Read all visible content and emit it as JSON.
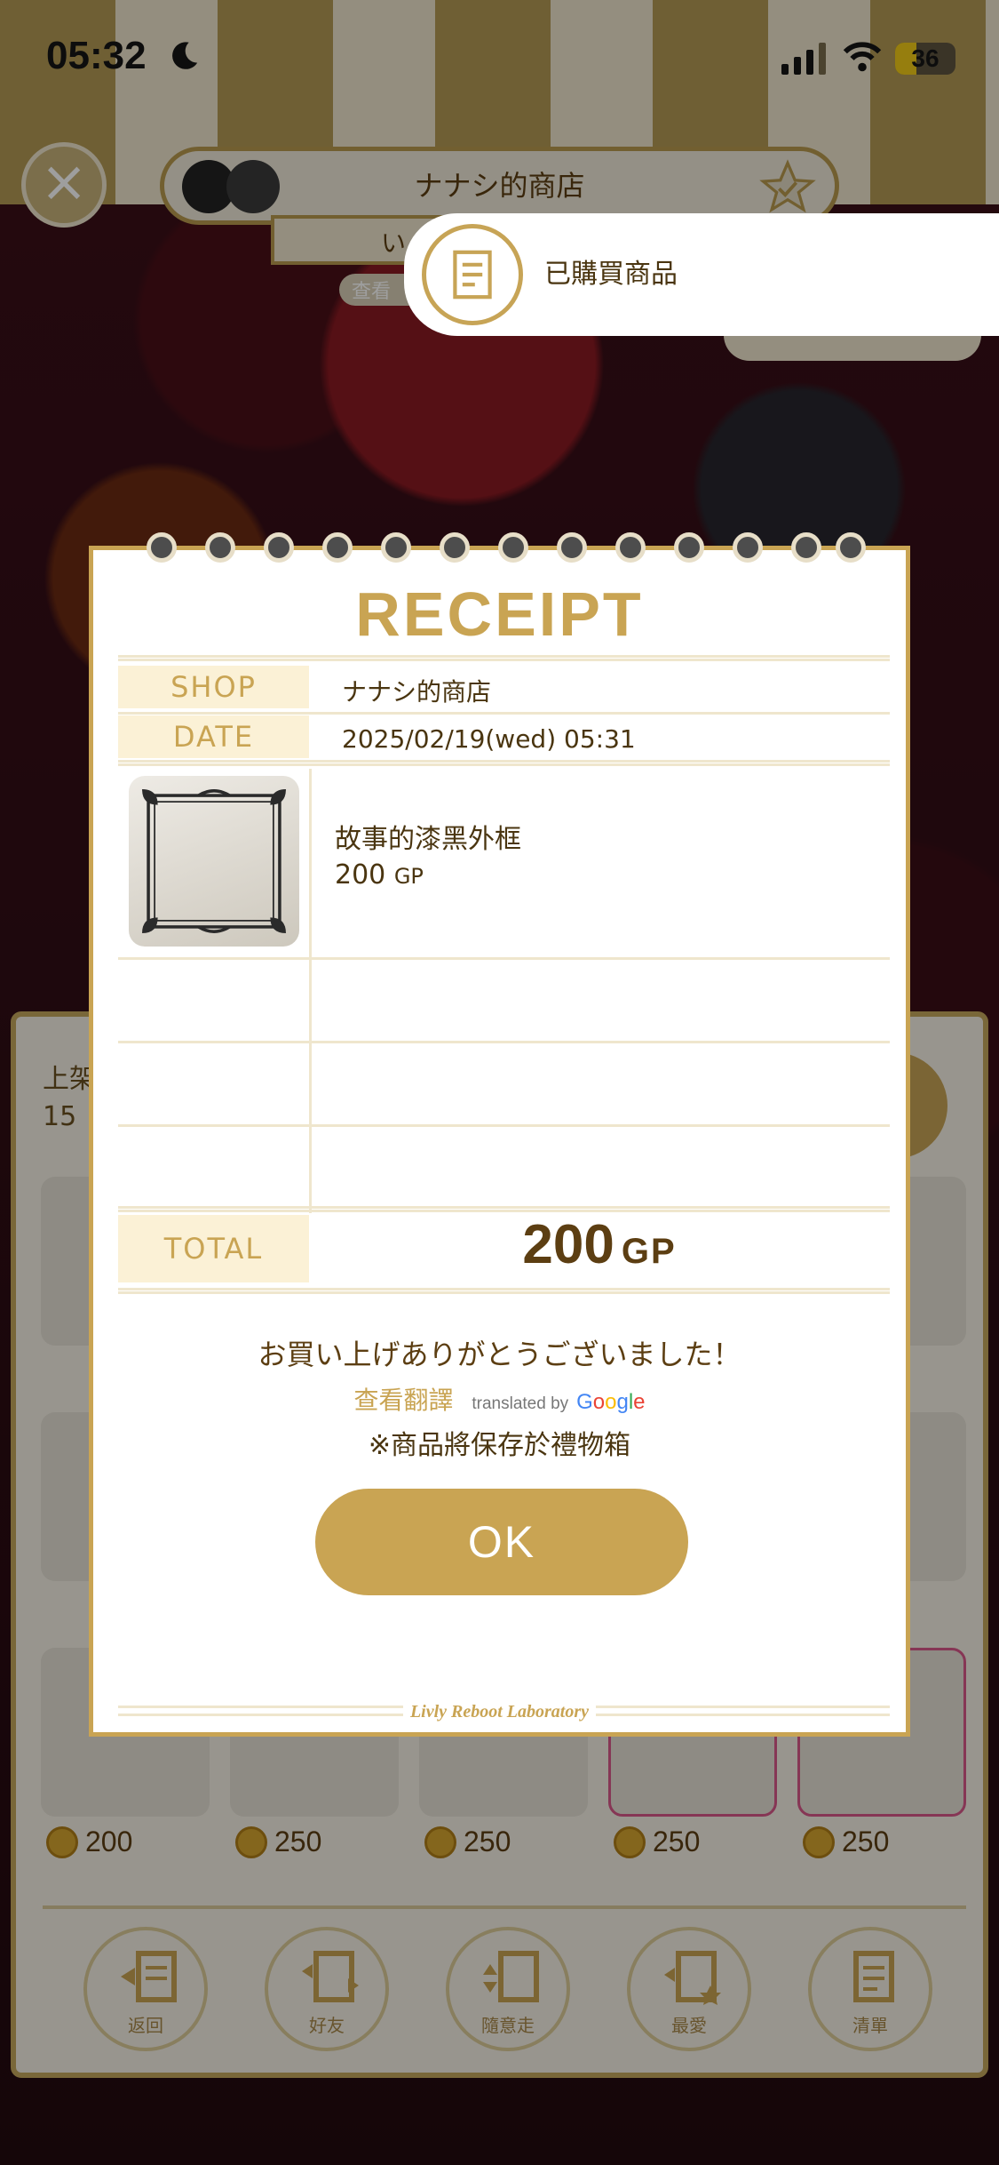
{
  "status_bar": {
    "time": "05:32",
    "battery": "36",
    "battery_level": 0.36
  },
  "header": {
    "shop_title": "ナナシ的商店",
    "sub_tab_label": "い",
    "view_label": "查看"
  },
  "toast": {
    "text": "已購買商品",
    "icon": "receipt-icon"
  },
  "receipt": {
    "title": "RECEIPT",
    "shop_label": "SHOP",
    "shop_value": "ナナシ的商店",
    "date_label": "DATE",
    "date_value": "2025/02/19(wed) 05:31",
    "item_name": "故事的漆黑外框",
    "item_price": "200",
    "item_price_unit": "GP",
    "total_label": "TOTAL",
    "total_value": "200",
    "total_unit": "GP",
    "thanks": "お買い上げありがとうございました！",
    "translate_link": "查看翻譯",
    "translated_by": "translated by",
    "google": [
      "G",
      "o",
      "o",
      "g",
      "l",
      "e"
    ],
    "note": "※商品將保存於禮物箱",
    "ok": "OK",
    "footer": "Livly Reboot Laboratory"
  },
  "panel": {
    "top_text_1": "上架",
    "top_text_2": "15",
    "row3_prices": [
      "200",
      "250",
      "250",
      "250",
      "250"
    ]
  },
  "nav": [
    {
      "label": "返回",
      "icon": "back-icon"
    },
    {
      "label": "好友",
      "icon": "friends-icon"
    },
    {
      "label": "隨意走",
      "icon": "random-walk-icon"
    },
    {
      "label": "最愛",
      "icon": "favorite-icon"
    },
    {
      "label": "清單",
      "icon": "list-icon"
    }
  ],
  "colors": {
    "gold": "#c9a453",
    "brown_text": "#4a3510",
    "label_bg": "#fbf1d6"
  }
}
